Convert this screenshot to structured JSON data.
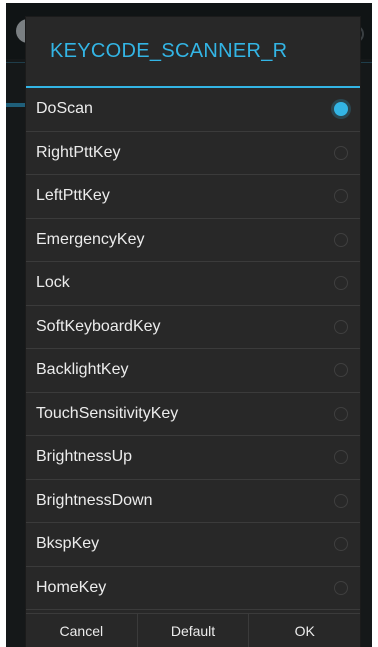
{
  "dialog": {
    "title": "KEYCODE_SCANNER_R",
    "selected_index": 0,
    "options": [
      {
        "label": "DoScan",
        "checked": true
      },
      {
        "label": "RightPttKey",
        "checked": false
      },
      {
        "label": "LeftPttKey",
        "checked": false
      },
      {
        "label": "EmergencyKey",
        "checked": false
      },
      {
        "label": "Lock",
        "checked": false
      },
      {
        "label": "SoftKeyboardKey",
        "checked": false
      },
      {
        "label": "BacklightKey",
        "checked": false
      },
      {
        "label": "TouchSensitivityKey",
        "checked": false
      },
      {
        "label": "BrightnessUp",
        "checked": false
      },
      {
        "label": "BrightnessDown",
        "checked": false
      },
      {
        "label": "BkspKey",
        "checked": false
      },
      {
        "label": "HomeKey",
        "checked": false
      }
    ],
    "buttons": {
      "cancel": "Cancel",
      "default": "Default",
      "ok": "OK"
    }
  },
  "colors": {
    "accent": "#33b5e5",
    "dialog_bg": "#282828",
    "text": "#ececec"
  }
}
